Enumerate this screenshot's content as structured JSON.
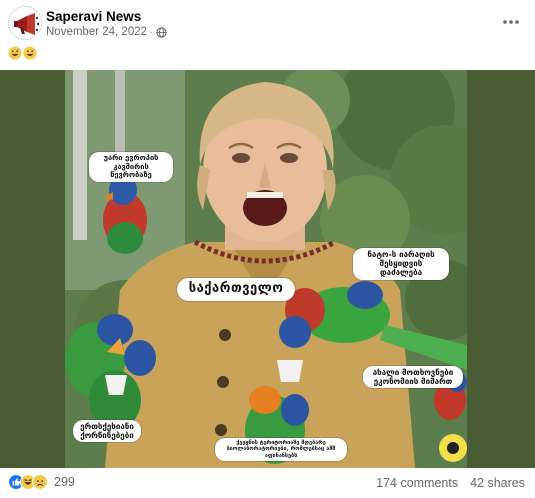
{
  "post": {
    "page_name": "Saperavi News",
    "date": "November 24, 2022",
    "separator": "·",
    "privacy_icon": "globe-icon",
    "more_icon": "more-options-icon",
    "caption_emojis": [
      "grinning-sweat-emoji",
      "grinning-sweat-emoji"
    ]
  },
  "image": {
    "labels": {
      "a": "უარი ევროპის კავშირის წევრობაზე",
      "b": "ნატო-ს იარაღის შესყიდვის დაძალება",
      "c": "საქართველო",
      "d": "ახალი მოთხოვნები ეკონომიის მიმართ",
      "e": "ერთსქესიანი ქორწინებები",
      "f": "ქვეყნის ტერიტორიაზე მდებარე ბიოლაბორატორიები, რომლებსაც აშშ აფინანსებს"
    },
    "colors": {
      "side_panel": "#4a5c33",
      "jacket": "#c9a35a",
      "hair": "#d8b889"
    }
  },
  "footer": {
    "reaction_icons": [
      "like-icon",
      "haha-icon",
      "sad-icon"
    ],
    "reaction_count": "299",
    "comments": "174 comments",
    "shares": "42 shares"
  }
}
